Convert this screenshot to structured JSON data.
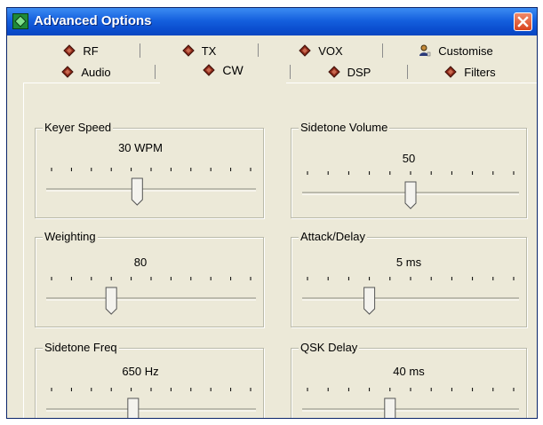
{
  "window": {
    "title": "Advanced Options"
  },
  "tabs": {
    "row1": [
      {
        "label": "RF",
        "icon": "diamond-icon"
      },
      {
        "label": "TX",
        "icon": "diamond-icon"
      },
      {
        "label": "VOX",
        "icon": "diamond-icon"
      },
      {
        "label": "Customise",
        "icon": "person-icon"
      }
    ],
    "row2": [
      {
        "label": "Audio",
        "icon": "diamond-icon"
      },
      {
        "label": "CW",
        "icon": "diamond-icon",
        "active": true
      },
      {
        "label": "DSP",
        "icon": "diamond-icon"
      },
      {
        "label": "Filters",
        "icon": "diamond-icon"
      }
    ]
  },
  "groups": {
    "keyer_speed": {
      "label": "Keyer Speed",
      "value": "30 WPM",
      "level": 0.43
    },
    "sidetone_volume": {
      "label": "Sidetone Volume",
      "value": "50",
      "level": 0.5
    },
    "weighting": {
      "label": "Weighting",
      "value": "80",
      "level": 0.3
    },
    "attack_delay": {
      "label": "Attack/Delay",
      "value": "5 ms",
      "level": 0.3
    },
    "sidetone_freq": {
      "label": "Sidetone Freq",
      "value": "650 Hz",
      "level": 0.41
    },
    "qsk_delay": {
      "label": "QSK Delay",
      "value": "40 ms",
      "level": 0.4
    }
  },
  "colors": {
    "titlebar": "#0b4fd0",
    "face": "#ece9d8",
    "close": "#d9431e",
    "diamond": "#8b2a1a"
  }
}
